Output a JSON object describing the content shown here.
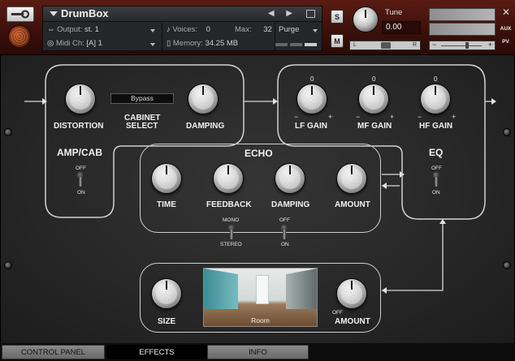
{
  "header": {
    "instrument_name": "DrumBox",
    "nav_arrows": "◀ ▶",
    "output_label": "Output:",
    "output_value": "st. 1",
    "voices_label": "Voices:",
    "voices_value": "0",
    "max_label": "Max:",
    "max_value": "32",
    "purge_label": "Purge",
    "midi_label": "Midi Ch:",
    "midi_value": "[A]  1",
    "memory_label": "Memory:",
    "memory_value": "34.25 MB",
    "solo_label": "S",
    "mute_label": "M",
    "tune_label": "Tune",
    "tune_value": "0.00",
    "pan_left": "L",
    "pan_right": "R",
    "vol_minus": "−",
    "vol_plus": "+",
    "aux_label": "AUX",
    "pv_label": "PV"
  },
  "amp_cab": {
    "title": "AMP/CAB",
    "distortion": "DISTORTION",
    "cabinet_select_line1": "CABINET",
    "cabinet_select_line2": "SELECT",
    "cabinet_value": "Bypass",
    "damping": "DAMPING",
    "toggle_off": "OFF",
    "toggle_on": "ON"
  },
  "eq": {
    "title": "EQ",
    "lf_gain": "LF GAIN",
    "mf_gain": "MF GAIN",
    "hf_gain": "HF GAIN",
    "center": "0",
    "minus": "−",
    "plus": "+",
    "toggle_off": "OFF",
    "toggle_on": "ON"
  },
  "echo": {
    "title": "ECHO",
    "time": "TIME",
    "feedback": "FEEDBACK",
    "damping": "DAMPING",
    "amount": "AMOUNT",
    "mono": "MONO",
    "stereo": "STEREO",
    "toggle_off": "OFF",
    "toggle_on": "ON"
  },
  "reverb": {
    "size": "SIZE",
    "room": "Room",
    "amount": "AMOUNT",
    "amount_off": "OFF"
  },
  "tabs": {
    "control_panel": "CONTROL PANEL",
    "effects": "EFFECTS",
    "info": "INFO"
  }
}
